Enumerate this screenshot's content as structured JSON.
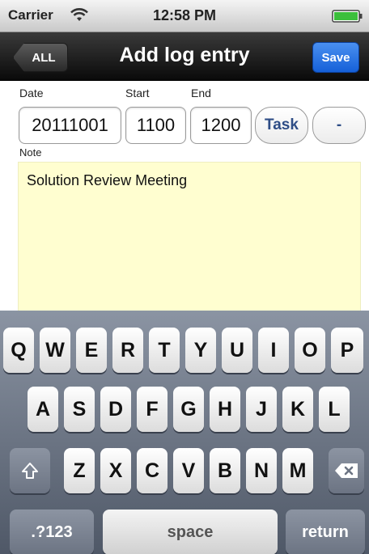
{
  "status_bar": {
    "carrier": "Carrier",
    "time": "12:58 PM"
  },
  "nav": {
    "back_label": "ALL",
    "title": "Add log entry",
    "save_label": "Save"
  },
  "form": {
    "date_label": "Date",
    "start_label": "Start",
    "end_label": "End",
    "date_value": "20111001",
    "start_value": "1100",
    "end_value": "1200",
    "task_button": "Task",
    "minus_button": "-",
    "note_label": "Note",
    "note_value": "Solution Review Meeting"
  },
  "keyboard": {
    "row1": [
      "Q",
      "W",
      "E",
      "R",
      "T",
      "Y",
      "U",
      "I",
      "O",
      "P"
    ],
    "row2": [
      "A",
      "S",
      "D",
      "F",
      "G",
      "H",
      "J",
      "K",
      "L"
    ],
    "row3": [
      "Z",
      "X",
      "C",
      "V",
      "B",
      "N",
      "M"
    ],
    "numbers_key": ".?123",
    "space_key": "space",
    "return_key": "return",
    "shift_icon": "shift-icon",
    "delete_icon": "backspace-icon"
  },
  "colors": {
    "save_blue": "#1560d8",
    "note_bg": "#fffed0",
    "task_text": "#2e4d86"
  }
}
